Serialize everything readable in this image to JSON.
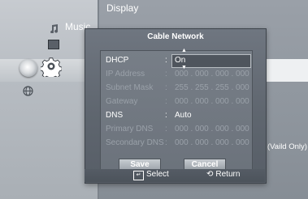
{
  "menu": {
    "music_label": "Music",
    "display_label": "Display"
  },
  "side_note": "(Vaild Only)",
  "dialog": {
    "title": "Cable Network",
    "rows": [
      {
        "label": "DHCP",
        "value": "On"
      },
      {
        "label": "IP Address",
        "value": "000 . 000 . 000 . 000"
      },
      {
        "label": "Subnet Mask",
        "value": "255 . 255 . 255 . 000"
      },
      {
        "label": "Gateway",
        "value": "000 . 000 . 000 . 000"
      },
      {
        "label": "DNS",
        "value": "Auto"
      },
      {
        "label": "Primary DNS",
        "value": "000 . 000 . 000 . 000"
      },
      {
        "label": "Secondary DNS",
        "value": "000 . 000 . 000 . 000"
      }
    ],
    "save_label": "Save",
    "cancel_label": "Cancel"
  },
  "footer": {
    "select_label": "Select",
    "return_label": "Return"
  },
  "icons": [
    "music-icon",
    "dvd-icon",
    "gear-icon",
    "globe-icon",
    "enter-icon",
    "return-icon"
  ]
}
